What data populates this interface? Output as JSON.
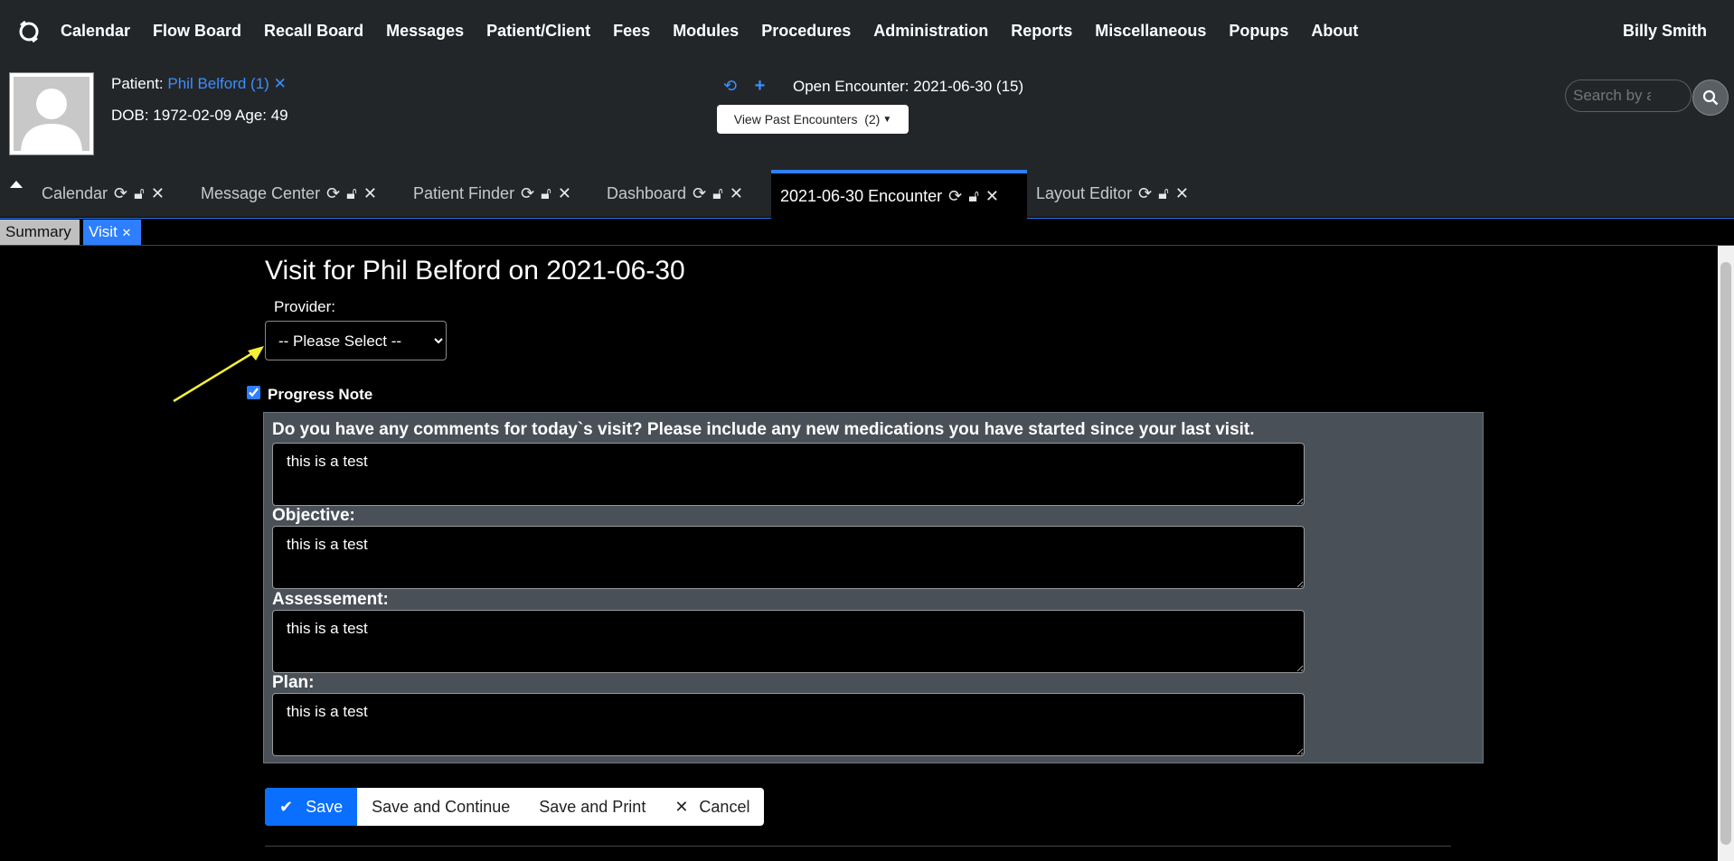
{
  "menu": {
    "items": [
      "Calendar",
      "Flow Board",
      "Recall Board",
      "Messages",
      "Patient/Client",
      "Fees",
      "Modules",
      "Procedures",
      "Administration",
      "Reports",
      "Miscellaneous",
      "Popups",
      "About"
    ],
    "user": "Billy Smith"
  },
  "patient": {
    "label": "Patient:",
    "name": "Phil Belford (1)",
    "dob_text": "DOB: 1972-02-09 Age: 49"
  },
  "encounter": {
    "open_text": "Open Encounter: 2021-06-30 (15)",
    "past_label": "View Past Encounters",
    "past_count": "(2)"
  },
  "search": {
    "placeholder": "Search by any demographics"
  },
  "tabs": [
    {
      "label": "Calendar"
    },
    {
      "label": "Message Center"
    },
    {
      "label": "Patient Finder"
    },
    {
      "label": "Dashboard"
    },
    {
      "label": "2021-06-30 Encounter",
      "active": true
    },
    {
      "label": "Layout Editor"
    }
  ],
  "subtabs": {
    "summary": "Summary",
    "visit": "Visit"
  },
  "form": {
    "title": "Visit for Phil Belford on 2021-06-30",
    "provider_label": "Provider:",
    "provider_value": "-- Please Select --",
    "progress_note_label": "Progress Note",
    "progress_note_checked": true,
    "questions": [
      {
        "label": "Do you have any comments for today`s visit? Please include any new medications you have started since your last visit.",
        "value": "this is a test"
      },
      {
        "label": "Objective:",
        "value": "this is a test"
      },
      {
        "label": "Assessement:",
        "value": "this is a test"
      },
      {
        "label": "Plan:",
        "value": "this is a test"
      }
    ]
  },
  "buttons": {
    "save": "Save",
    "save_continue": "Save and Continue",
    "save_print": "Save and Print",
    "cancel": "Cancel"
  },
  "colors": {
    "accent": "#2d7fff",
    "header_bg": "#232629",
    "panel_bg": "#495057",
    "annotation_arrow": "#f5ef3a"
  }
}
